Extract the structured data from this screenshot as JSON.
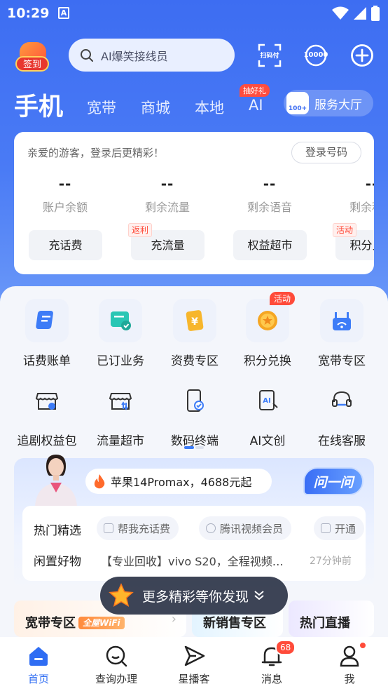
{
  "status_bar": {
    "time": "10:29",
    "app_glyph": "A"
  },
  "header": {
    "signin_label": "签到",
    "search_placeholder": "AI爆笑接线员",
    "scan_label": "扫码付",
    "hotline_label": "10000"
  },
  "tabs": [
    {
      "label": "手机",
      "active": true
    },
    {
      "label": "宽带"
    },
    {
      "label": "商城"
    },
    {
      "label": "本地"
    },
    {
      "label": "AI",
      "badge": "抽好礼"
    }
  ],
  "hall": {
    "label": "服务大厅",
    "icon_text": "100+"
  },
  "account": {
    "greeting": "亲爱的游客，登录后更精彩！",
    "login_button": "登录号码",
    "stats": [
      {
        "value": "--",
        "label": "账户余额",
        "button": "充话费"
      },
      {
        "value": "--",
        "label": "剩余流量",
        "button": "充流量",
        "tag": "返利"
      },
      {
        "value": "--",
        "label": "剩余语音",
        "button": "权益超市"
      },
      {
        "value": "--",
        "label": "剩余积分",
        "button": "积分兑换",
        "tag": "活动"
      }
    ]
  },
  "services": [
    {
      "label": "话费账单",
      "icon": "bill-icon"
    },
    {
      "label": "已订业务",
      "icon": "subscribed-icon"
    },
    {
      "label": "资费专区",
      "icon": "tariff-icon"
    },
    {
      "label": "积分兑换",
      "icon": "points-icon",
      "badge": "活动"
    },
    {
      "label": "宽带专区",
      "icon": "router-icon"
    },
    {
      "label": "追剧权益包",
      "icon": "drama-store-icon"
    },
    {
      "label": "流量超市",
      "icon": "data-store-icon"
    },
    {
      "label": "数码终端",
      "icon": "phone-check-icon"
    },
    {
      "label": "AI文创",
      "icon": "ai-doc-icon"
    },
    {
      "label": "在线客服",
      "icon": "headset-icon"
    }
  ],
  "promo": {
    "headline": "苹果14Promax，4688元起",
    "ask_button": "问一问",
    "hot_title": "热门精选",
    "chips": [
      "帮我充话费",
      "腾讯视频会员",
      "开通"
    ],
    "used_title": "闲置好物",
    "used_text": "【专业回收】vivo S20，全程视频…",
    "used_time": "27分钟前"
  },
  "categories": [
    {
      "label": "宽带专区",
      "tag": "全屋WiFi"
    },
    {
      "label": "新销售专区"
    },
    {
      "label": "热门直播"
    }
  ],
  "toast": {
    "text": "更多精彩等你发现"
  },
  "bottom_nav": [
    {
      "label": "首页",
      "icon": "home-icon",
      "active": true
    },
    {
      "label": "查询办理",
      "icon": "search-icon"
    },
    {
      "label": "星播客",
      "icon": "podcast-icon"
    },
    {
      "label": "消息",
      "icon": "bell-icon",
      "badge": "68"
    },
    {
      "label": "我",
      "icon": "user-icon",
      "dot": true
    }
  ],
  "colors": {
    "brand_blue": "#3d6df2",
    "accent_red": "#ff4b3a"
  }
}
